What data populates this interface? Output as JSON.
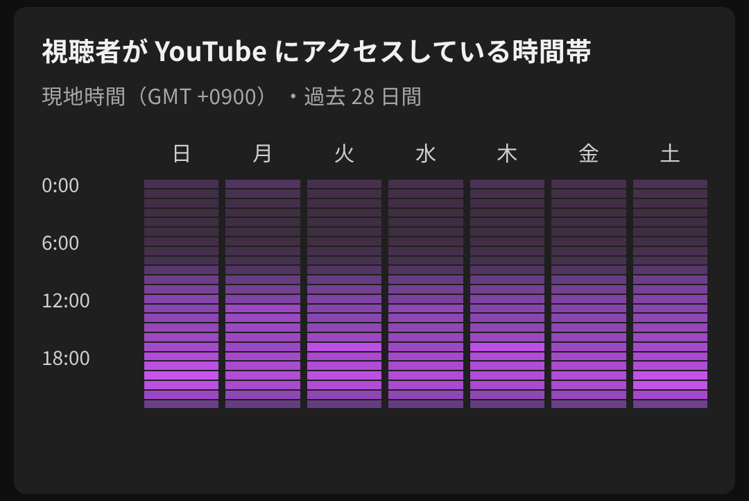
{
  "title": "視聴者が YouTube にアクセスしている時間帯",
  "subtitle": "現地時間（GMT +0900） ・過去 28 日間",
  "chart_data": {
    "type": "heatmap",
    "note": "Relative viewer activity by hour of day and day of week. Values 0–100 are approximate intensity read from shading.",
    "hours": [
      0,
      1,
      2,
      3,
      4,
      5,
      6,
      7,
      8,
      9,
      10,
      11,
      12,
      13,
      14,
      15,
      16,
      17,
      18,
      19,
      20,
      21,
      22,
      23
    ],
    "y_tick_labels": [
      "0:00",
      "6:00",
      "12:00",
      "18:00"
    ],
    "y_tick_hours": [
      0,
      6,
      12,
      18
    ],
    "days": [
      "日",
      "月",
      "火",
      "水",
      "木",
      "金",
      "土"
    ],
    "series": [
      {
        "name": "日",
        "values": [
          25,
          15,
          12,
          10,
          10,
          10,
          15,
          20,
          25,
          40,
          55,
          65,
          75,
          78,
          80,
          82,
          85,
          88,
          92,
          95,
          98,
          95,
          85,
          55
        ]
      },
      {
        "name": "月",
        "values": [
          35,
          25,
          15,
          10,
          10,
          10,
          12,
          20,
          25,
          35,
          50,
          60,
          70,
          85,
          85,
          85,
          85,
          85,
          88,
          90,
          92,
          90,
          80,
          50
        ]
      },
      {
        "name": "火",
        "values": [
          22,
          15,
          12,
          10,
          10,
          10,
          12,
          20,
          25,
          35,
          50,
          60,
          70,
          75,
          78,
          80,
          85,
          95,
          90,
          92,
          95,
          92,
          80,
          50
        ]
      },
      {
        "name": "水",
        "values": [
          22,
          15,
          12,
          10,
          10,
          10,
          12,
          20,
          25,
          35,
          50,
          60,
          65,
          80,
          80,
          80,
          82,
          85,
          88,
          90,
          92,
          90,
          80,
          50
        ]
      },
      {
        "name": "木",
        "values": [
          30,
          18,
          14,
          10,
          10,
          10,
          12,
          20,
          25,
          35,
          50,
          60,
          70,
          75,
          78,
          80,
          85,
          95,
          92,
          92,
          92,
          90,
          80,
          50
        ]
      },
      {
        "name": "金",
        "values": [
          22,
          15,
          12,
          10,
          10,
          10,
          12,
          20,
          25,
          35,
          50,
          60,
          70,
          75,
          78,
          80,
          82,
          85,
          88,
          90,
          92,
          90,
          82,
          55
        ]
      },
      {
        "name": "土",
        "values": [
          28,
          18,
          14,
          10,
          10,
          10,
          14,
          22,
          28,
          40,
          55,
          65,
          72,
          76,
          80,
          82,
          85,
          88,
          90,
          92,
          97,
          97,
          88,
          58
        ]
      }
    ]
  }
}
